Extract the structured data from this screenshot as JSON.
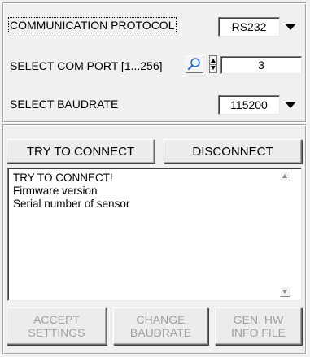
{
  "settings": {
    "protocol_label": "COMMUNICATION PROTOCOL",
    "protocol_value": "RS232",
    "com_port_label": "SELECT COM PORT [1...256]",
    "com_port_value": "3",
    "baudrate_label": "SELECT BAUDRATE",
    "baudrate_value": "115200"
  },
  "connection": {
    "connect_label": "TRY TO CONNECT",
    "disconnect_label": "DISCONNECT"
  },
  "log": {
    "lines": [
      "TRY TO CONNECT!",
      "Firmware version",
      "Serial number of sensor"
    ]
  },
  "actions": {
    "accept_label": "ACCEPT\nSETTINGS",
    "change_baud_label": "CHANGE\nBAUDRATE",
    "gen_hw_label": "GEN. HW\nINFO FILE"
  },
  "icons": {
    "dropdown": "chevron-down-icon",
    "browse": "magnifier-icon",
    "spinner": "spinner-icon"
  }
}
